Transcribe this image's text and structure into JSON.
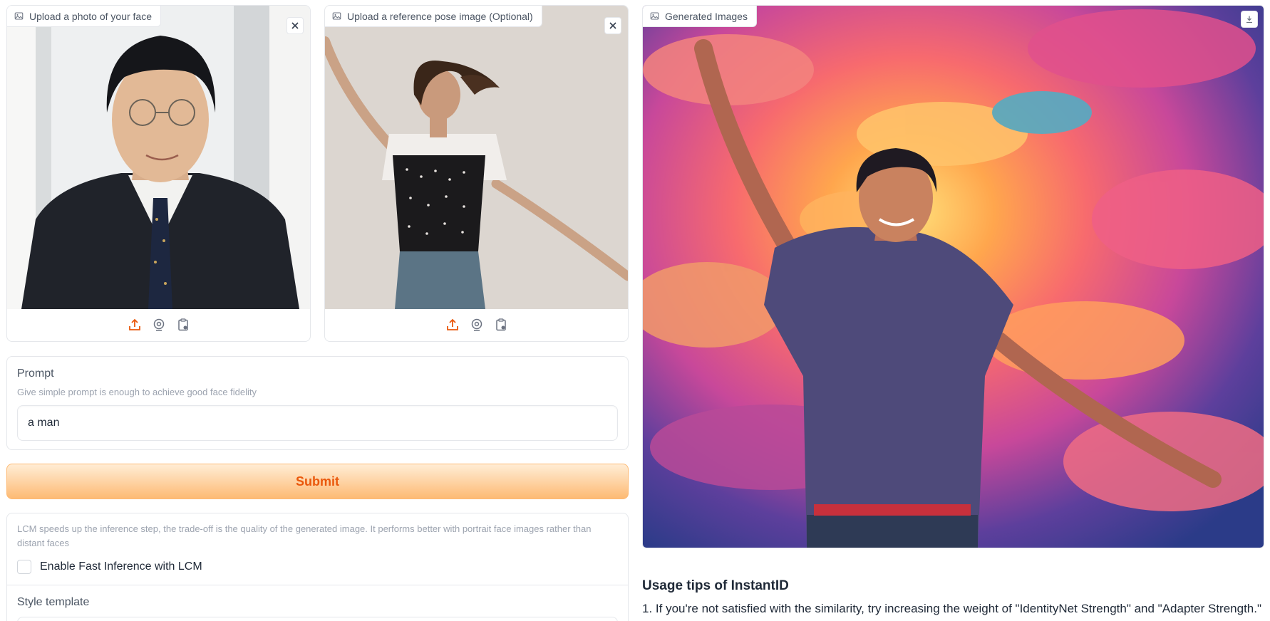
{
  "face_upload": {
    "label": "Upload a photo of your face",
    "icons": [
      "image-icon",
      "close-icon",
      "upload-icon",
      "webcam-icon",
      "clipboard-icon"
    ]
  },
  "pose_upload": {
    "label": "Upload a reference pose image (Optional)",
    "icons": [
      "image-icon",
      "close-icon",
      "upload-icon",
      "webcam-icon",
      "clipboard-icon"
    ]
  },
  "output": {
    "label": "Generated Images",
    "icons": [
      "image-icon",
      "download-icon"
    ]
  },
  "prompt": {
    "label": "Prompt",
    "info": "Give simple prompt is enough to achieve good face fidelity",
    "value": "a man"
  },
  "submit": {
    "label": "Submit"
  },
  "lcm": {
    "info": "LCM speeds up the inference step, the trade-off is the quality of the generated image. It performs better with portrait face images rather than distant faces",
    "checkbox_label": "Enable Fast Inference with LCM",
    "checked": false
  },
  "style": {
    "label": "Style template"
  },
  "tips": {
    "title": "Usage tips of InstantID",
    "lines": [
      "1. If you're not satisfied with the similarity, try increasing the weight of \"IdentityNet Strength\" and \"Adapter Strength.\""
    ]
  },
  "colors": {
    "accent": "#ea580c",
    "submit_light": "#ffedd5",
    "submit_dark": "#fdba74",
    "border": "#e5e7eb"
  }
}
